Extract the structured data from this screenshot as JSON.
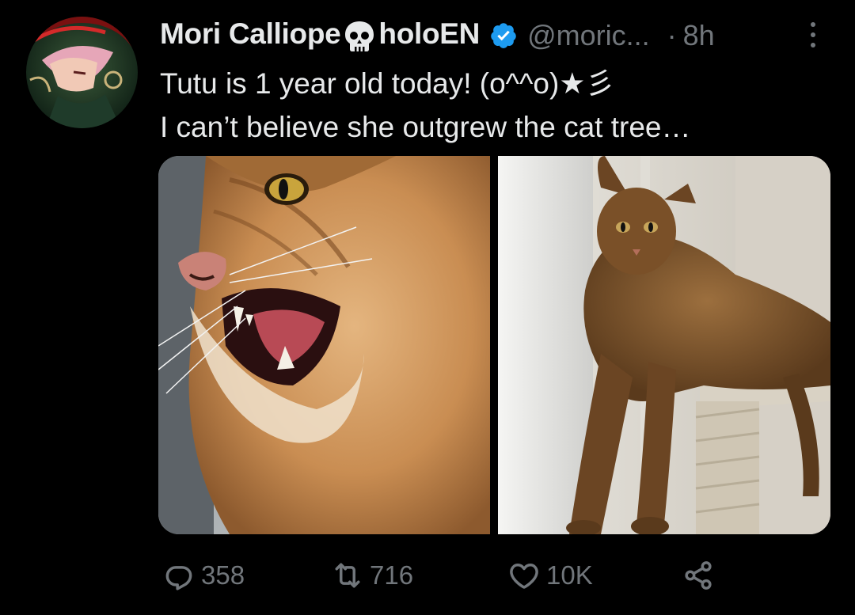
{
  "tweet": {
    "author": {
      "name_part1": "Mori Calliope",
      "name_part2": "holoEN",
      "handle": "@moric...",
      "avatar_icon": "profile-avatar-icon",
      "verified_icon": "verified-badge-icon",
      "emoji_icon": "skull-icon"
    },
    "separator": "·",
    "timestamp": "8h",
    "text_lines": [
      "Tutu is 1 year old today! (o^^o)★彡",
      "I can’t believe she outgrew the cat tree…"
    ],
    "media": [
      {
        "icon": "photo-cat-closeup"
      },
      {
        "icon": "photo-cat-on-tree"
      }
    ],
    "actions": {
      "reply_count": "358",
      "retweet_count": "716",
      "like_count": "10K"
    }
  },
  "colors": {
    "background": "#000000",
    "text_primary": "#e7e9ea",
    "text_secondary": "#71767b",
    "verified_blue": "#1d9bf0"
  }
}
